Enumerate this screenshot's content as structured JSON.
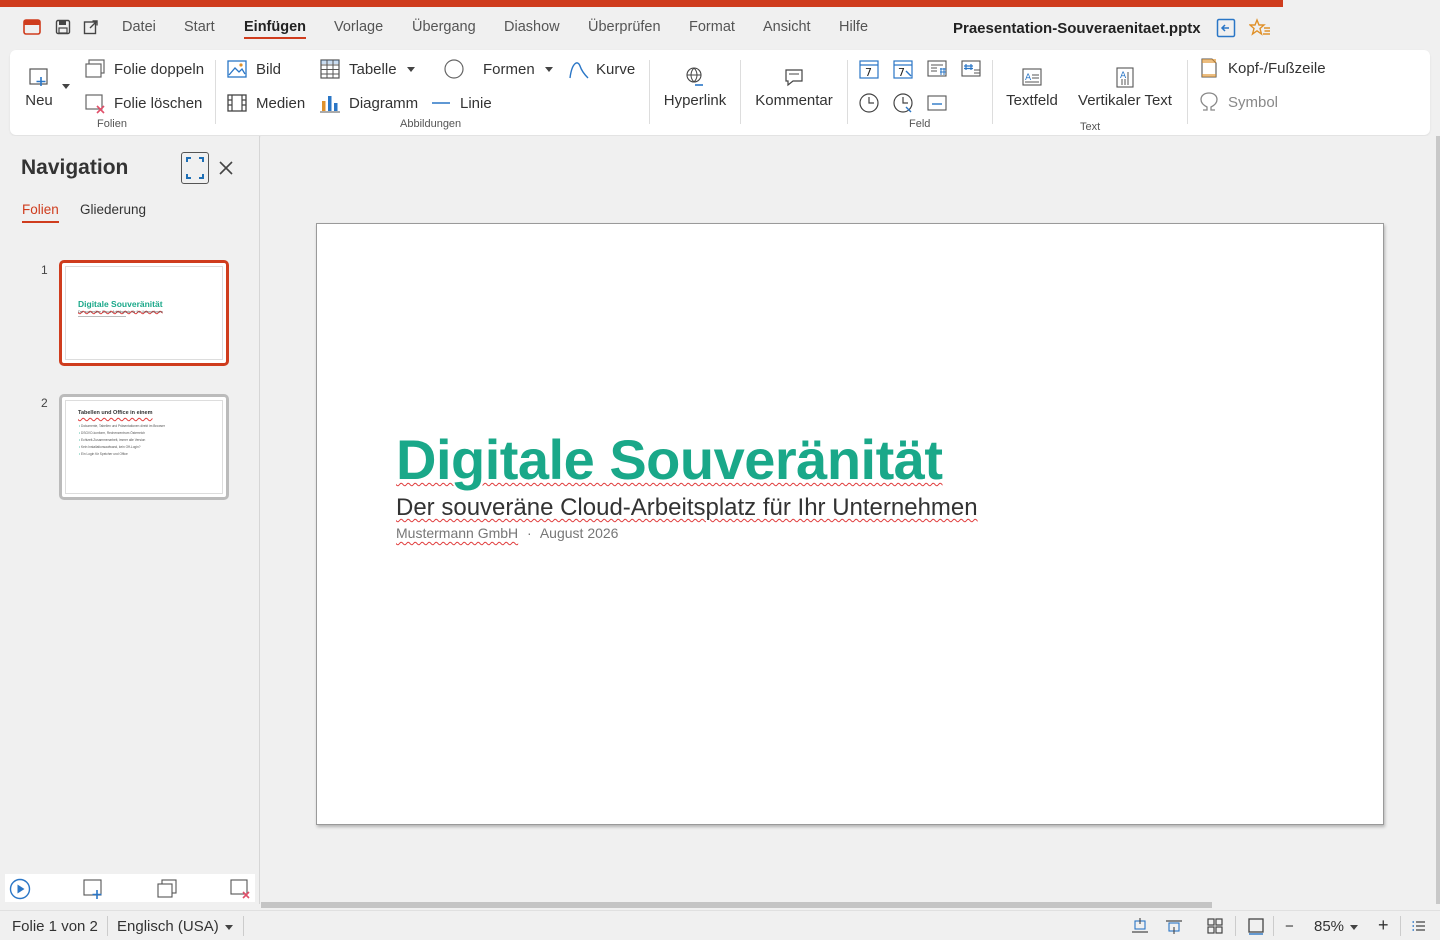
{
  "app": {
    "document_title": "Praesentation-Souveraenitaet.pptx",
    "accent_color": "#cf3c1d",
    "slide_accent_color": "#1aa889"
  },
  "menu": {
    "items": [
      {
        "label": "Datei",
        "active": false
      },
      {
        "label": "Start",
        "active": false
      },
      {
        "label": "Einfügen",
        "active": true
      },
      {
        "label": "Vorlage",
        "active": false
      },
      {
        "label": "Übergang",
        "active": false
      },
      {
        "label": "Diashow",
        "active": false
      },
      {
        "label": "Überprüfen",
        "active": false
      },
      {
        "label": "Format",
        "active": false
      },
      {
        "label": "Ansicht",
        "active": false
      },
      {
        "label": "Hilfe",
        "active": false
      }
    ]
  },
  "ribbon": {
    "new_label": "Neu",
    "duplicate_slide": "Folie doppeln",
    "delete_slide": "Folie löschen",
    "group_slides": "Folien",
    "image": "Bild",
    "media": "Medien",
    "table": "Tabelle",
    "chart": "Diagramm",
    "shapes": "Formen",
    "line": "Linie",
    "curve": "Kurve",
    "group_images": "Abbildungen",
    "hyperlink": "Hyperlink",
    "comment": "Kommentar",
    "group_field": "Feld",
    "textbox": "Textfeld",
    "vertical_text": "Vertikaler Text",
    "group_text": "Text",
    "header_footer": "Kopf-/Fußzeile",
    "symbol": "Symbol"
  },
  "navigation": {
    "title": "Navigation",
    "tabs": [
      {
        "label": "Folien",
        "active": true
      },
      {
        "label": "Gliederung",
        "active": false
      }
    ],
    "slides": [
      {
        "number": "1",
        "selected": true,
        "title": "Digitale Souveränität",
        "subtitle": "Der souveräne Cloud-Arbeitsplatz für Ihr Unternehmen"
      },
      {
        "number": "2",
        "selected": false,
        "title": "Tabellen und Office in einem",
        "bullets": [
          "Dokumente, Tabellen und Präsentationen direkt im Browser",
          "DSGVO-konform, Rechenzentrum Österreich",
          "Echtzeit-Zusammenarbeit, immer alle Version",
          "Kein Installationsaufwand, kein Off-Login?",
          "Ein Login für Speicher und Office"
        ]
      }
    ]
  },
  "slide": {
    "title": "Digitale Souveränität",
    "subtitle": "Der souveräne Cloud-Arbeitsplatz für Ihr Unternehmen",
    "company": "Mustermann GmbH",
    "meta_separator": "·",
    "date": "August 2026"
  },
  "status": {
    "slide_info": "Folie 1 von 2",
    "language": "Englisch (USA)",
    "zoom": "85%",
    "zoom_minus": "−",
    "zoom_plus": "+"
  }
}
